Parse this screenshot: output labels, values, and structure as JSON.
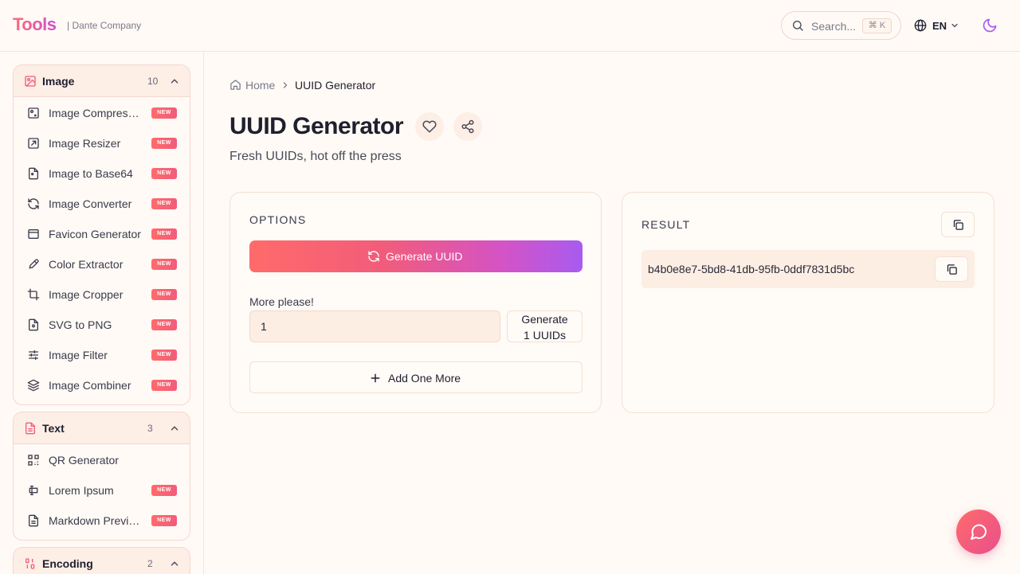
{
  "header": {
    "logo": "Tools",
    "company": "| Dante Company",
    "search_placeholder": "Search...",
    "search_shortcut": "⌘ K",
    "language": "EN"
  },
  "sidebar": {
    "groups": [
      {
        "title": "Image",
        "count": "10",
        "items": [
          {
            "label": "Image Compressor",
            "badge": "NEW",
            "icon": "image-compress-icon"
          },
          {
            "label": "Image Resizer",
            "badge": "NEW",
            "icon": "resize-icon"
          },
          {
            "label": "Image to Base64",
            "badge": "NEW",
            "icon": "file-image-icon"
          },
          {
            "label": "Image Converter",
            "badge": "NEW",
            "icon": "refresh-icon"
          },
          {
            "label": "Favicon Generator",
            "badge": "NEW",
            "icon": "browser-window-icon"
          },
          {
            "label": "Color Extractor",
            "badge": "NEW",
            "icon": "eyedropper-icon"
          },
          {
            "label": "Image Cropper",
            "badge": "NEW",
            "icon": "crop-icon"
          },
          {
            "label": "SVG to PNG",
            "badge": "NEW",
            "icon": "file-code-icon"
          },
          {
            "label": "Image Filter",
            "badge": "NEW",
            "icon": "sliders-icon"
          },
          {
            "label": "Image Combiner",
            "badge": "NEW",
            "icon": "layers-icon"
          }
        ]
      },
      {
        "title": "Text",
        "count": "3",
        "items": [
          {
            "label": "QR Generator",
            "badge": "",
            "icon": "qr-code-icon"
          },
          {
            "label": "Lorem Ipsum",
            "badge": "NEW",
            "icon": "text-cursor-icon"
          },
          {
            "label": "Markdown Preview",
            "badge": "NEW",
            "icon": "file-text-icon"
          }
        ]
      },
      {
        "title": "Encoding",
        "count": "2",
        "items": []
      }
    ]
  },
  "breadcrumb": {
    "home": "Home",
    "current": "UUID Generator"
  },
  "page": {
    "title": "UUID Generator",
    "subtitle": "Fresh UUIDs, hot off the press"
  },
  "options": {
    "label": "OPTIONS",
    "generate_button": "Generate UUID",
    "more_label": "More please!",
    "count_value": "1",
    "bulk_button_line1": "Generate",
    "bulk_button_line2": "1 UUIDs",
    "add_button": "Add One More"
  },
  "result": {
    "label": "RESULT",
    "uuids": [
      "b4b0e8e7-5bd8-41db-95fb-0ddf7831d5bc"
    ]
  },
  "colors": {
    "accent_start": "#ff6b6b",
    "accent_end": "#a85bf0",
    "badge": "#f25c7a",
    "background": "#fffaf5"
  }
}
